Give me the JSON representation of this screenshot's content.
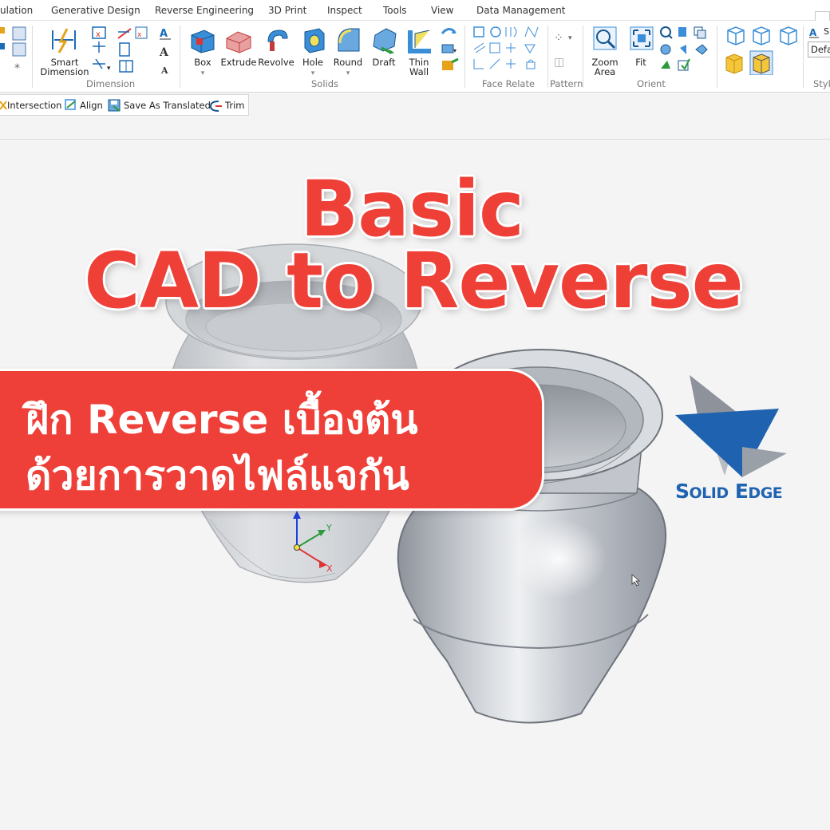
{
  "menubar": {
    "items": [
      "ulation",
      "Generative Design",
      "Reverse Engineering",
      "3D Print",
      "Inspect",
      "Tools",
      "View",
      "Data Management"
    ]
  },
  "ribbon": {
    "dimension": {
      "smart_dimension_line1": "Smart",
      "smart_dimension_line2": "Dimension",
      "group_label": "Dimension"
    },
    "solids": {
      "box": "Box",
      "extrude": "Extrude",
      "revolve": "Revolve",
      "hole": "Hole",
      "round": "Round",
      "draft": "Draft",
      "thin_wall_line1": "Thin",
      "thin_wall_line2": "Wall",
      "group_label": "Solids"
    },
    "face_relate": {
      "group_label": "Face Relate"
    },
    "pattern": {
      "group_label": "Pattern"
    },
    "orient": {
      "zoom_area_line1": "Zoom",
      "zoom_area_line2": "Area",
      "fit": "Fit",
      "group_label": "Orient"
    },
    "style": {
      "partial_label": "Styl",
      "default_value": "Defa",
      "s_label": "S"
    }
  },
  "quick_toolbar": {
    "intersection": "Intersection",
    "align": "Align",
    "save_as_translated": "Save As Translated",
    "trim": "Trim"
  },
  "overlay": {
    "title_line1": "Basic",
    "title_line2": "CAD to Reverse",
    "banner_line1": "ฝึก Reverse เบื้องต้น",
    "banner_line2": "ด้วยการวาดไฟล์แจกัน",
    "logo_text_s": "S",
    "logo_text_olid": "OLID",
    "logo_text_e": "E",
    "logo_text_dge": "DGE"
  },
  "triad": {
    "x_label": "X",
    "y_label": "Y"
  },
  "colors": {
    "title_red": "#ef4038",
    "banner_red": "#ee4038",
    "logo_blue": "#1f63b0",
    "vase_gray": "#b4b8bf"
  }
}
